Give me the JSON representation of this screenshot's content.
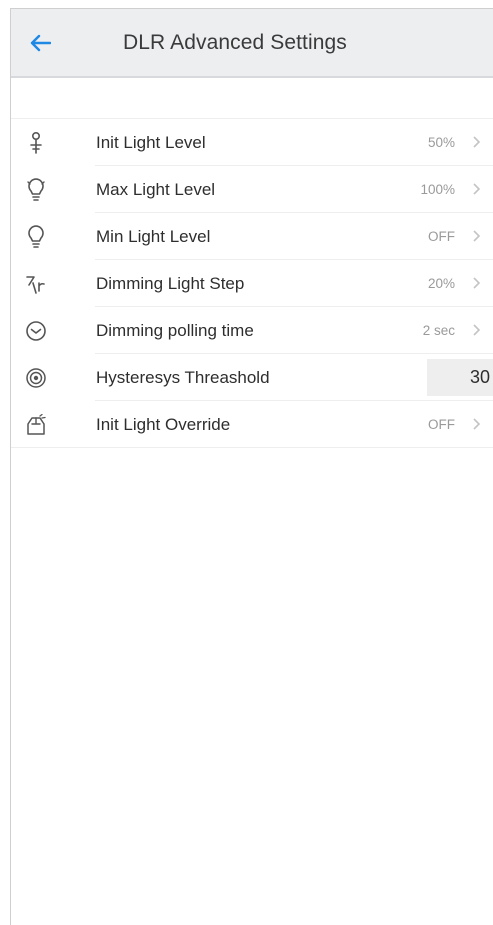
{
  "header": {
    "title": "DLR Advanced Settings",
    "back_icon": "back-arrow-icon",
    "accent_color": "#1e88e5",
    "background_color": "#eceef0"
  },
  "settings": [
    {
      "icon": "init-light-icon",
      "label": "Init Light Level",
      "value": "50%"
    },
    {
      "icon": "max-light-bulb-icon",
      "label": "Max Light Level",
      "value": "100%"
    },
    {
      "icon": "min-light-bulb-icon",
      "label": "Min Light Level",
      "value": "OFF"
    },
    {
      "icon": "dimming-step-icon",
      "label": "Dimming Light Step",
      "value": "20%"
    },
    {
      "icon": "clock-icon",
      "label": "Dimming polling time",
      "value": "2 sec"
    },
    {
      "icon": "target-icon",
      "label": "Hysteresys Threashold",
      "value": "30"
    },
    {
      "icon": "override-icon",
      "label": "Init Light Override",
      "value": "OFF"
    }
  ]
}
